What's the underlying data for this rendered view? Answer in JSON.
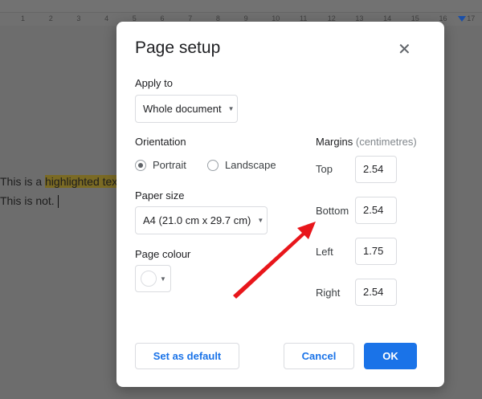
{
  "ruler": {
    "numbers": [
      "1",
      "2",
      "3",
      "4",
      "5",
      "6",
      "7",
      "8",
      "9",
      "10",
      "11",
      "12",
      "13",
      "14",
      "15",
      "16",
      "17"
    ]
  },
  "document": {
    "line1_plain": "This is a ",
    "line1_highlight": "highlighted text.",
    "line2": "This is not."
  },
  "dialog": {
    "title": "Page setup",
    "apply_to": {
      "label": "Apply to",
      "value": "Whole document"
    },
    "orientation": {
      "label": "Orientation",
      "options": [
        "Portrait",
        "Landscape"
      ],
      "selected": "Portrait"
    },
    "paper_size": {
      "label": "Paper size",
      "value": "A4 (21.0 cm x 29.7 cm)"
    },
    "page_colour": {
      "label": "Page colour",
      "value": "#ffffff"
    },
    "margins": {
      "label": "Margins",
      "unit": "(centimetres)",
      "top_label": "Top",
      "top": "2.54",
      "bottom_label": "Bottom",
      "bottom": "2.54",
      "left_label": "Left",
      "left": "1.75",
      "right_label": "Right",
      "right": "2.54"
    },
    "buttons": {
      "default": "Set as default",
      "cancel": "Cancel",
      "ok": "OK"
    }
  },
  "colors": {
    "accent": "#1a73e8",
    "arrow": "#e8161b",
    "highlight": "#7a6a24"
  }
}
